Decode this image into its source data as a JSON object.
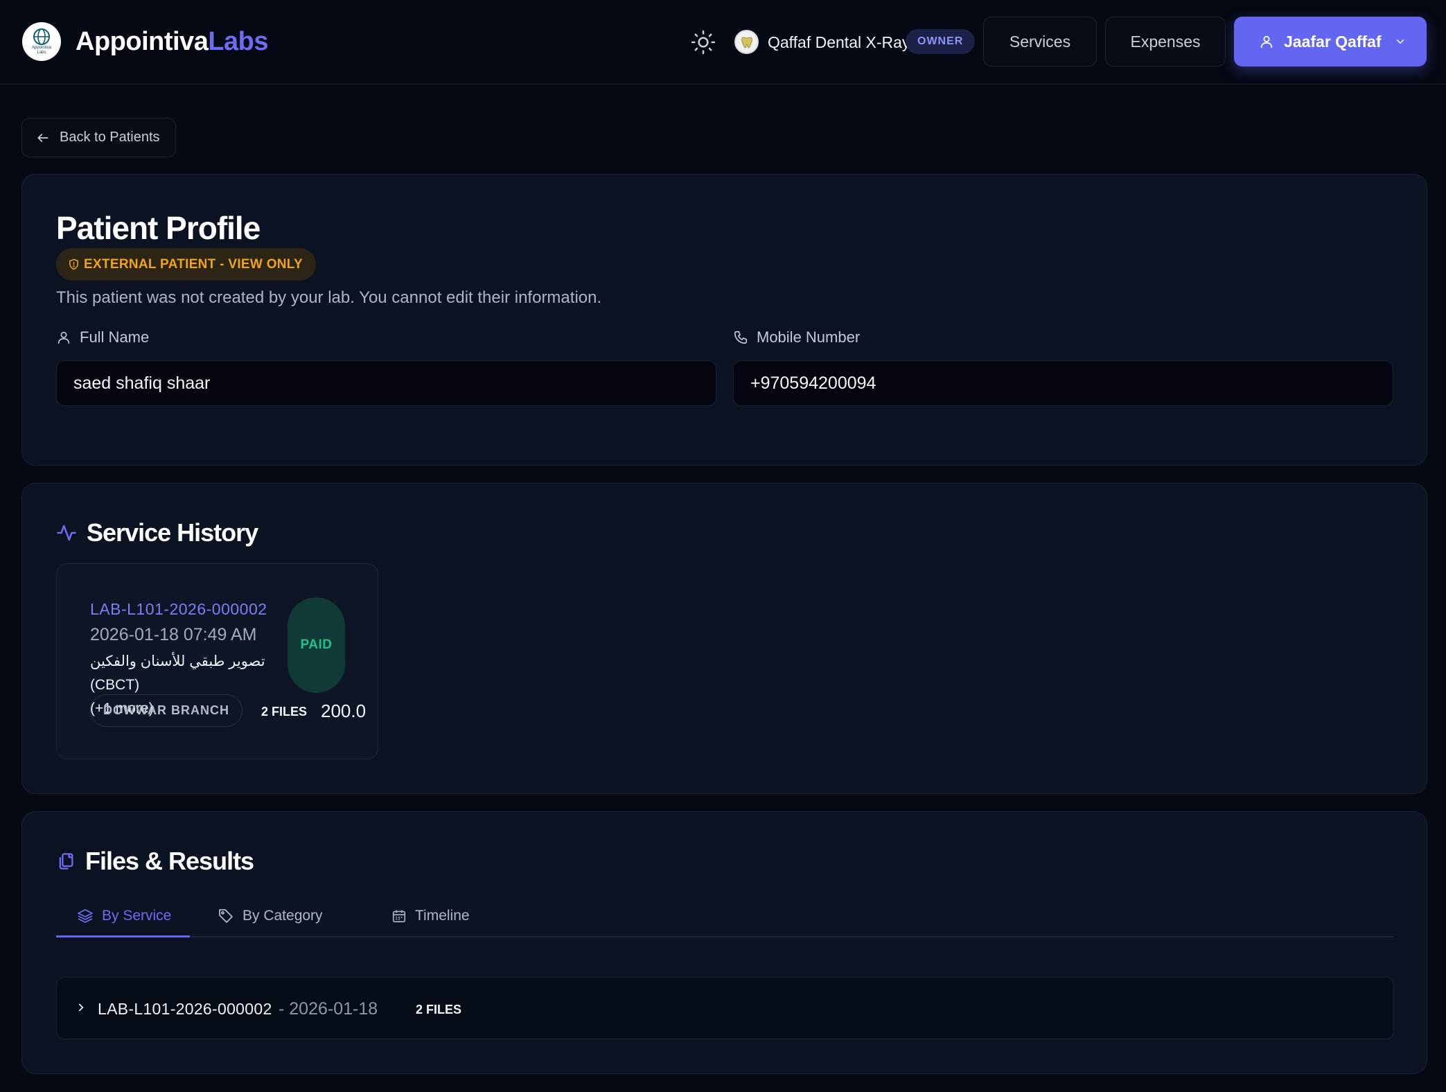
{
  "header": {
    "brand_part1": "Appointiva",
    "brand_part2": "Labs",
    "logo_small_text": "Appointiva",
    "logo_small_text2": "Labs",
    "lab_name": "Qaffaf Dental X-Ray",
    "role_badge": "OWNER",
    "nav": {
      "services": "Services",
      "expenses": "Expenses"
    },
    "user_name": "Jaafar Qaffaf",
    "icons": {
      "theme": "sun-icon",
      "user": "user-icon",
      "chevron": "chevron-down-icon"
    }
  },
  "back_button": "Back to Patients",
  "profile": {
    "title": "Patient Profile",
    "badge": "EXTERNAL PATIENT - VIEW ONLY",
    "note": "This patient was not created by your lab. You cannot edit their information.",
    "full_name_label": "Full Name",
    "full_name_value": "saed shafiq shaar",
    "mobile_label": "Mobile Number",
    "mobile_value": "+970594200094"
  },
  "service_history": {
    "title": "Service History",
    "items": [
      {
        "code": "LAB-L101-2026-000002",
        "datetime": "2026-01-18 07:49 AM",
        "description": "تصوير طبقي للأسنان والفكين (CBCT)",
        "more": "(+1 more)",
        "status": "PAID",
        "branch": "DOWWAR BRANCH",
        "files": "2 FILES",
        "amount": "200.0"
      }
    ]
  },
  "files_results": {
    "title": "Files & Results",
    "tabs": {
      "by_service": "By Service",
      "by_category": "By Category",
      "timeline": "Timeline"
    },
    "rows": [
      {
        "code": "LAB-L101-2026-000002",
        "date": "- 2026-01-18",
        "files": "2 FILES"
      }
    ]
  },
  "colors": {
    "background": "#050914",
    "card": "#0b1222",
    "accent": "#6366f1",
    "warning": "#f0a418",
    "success": "#22c08b"
  }
}
